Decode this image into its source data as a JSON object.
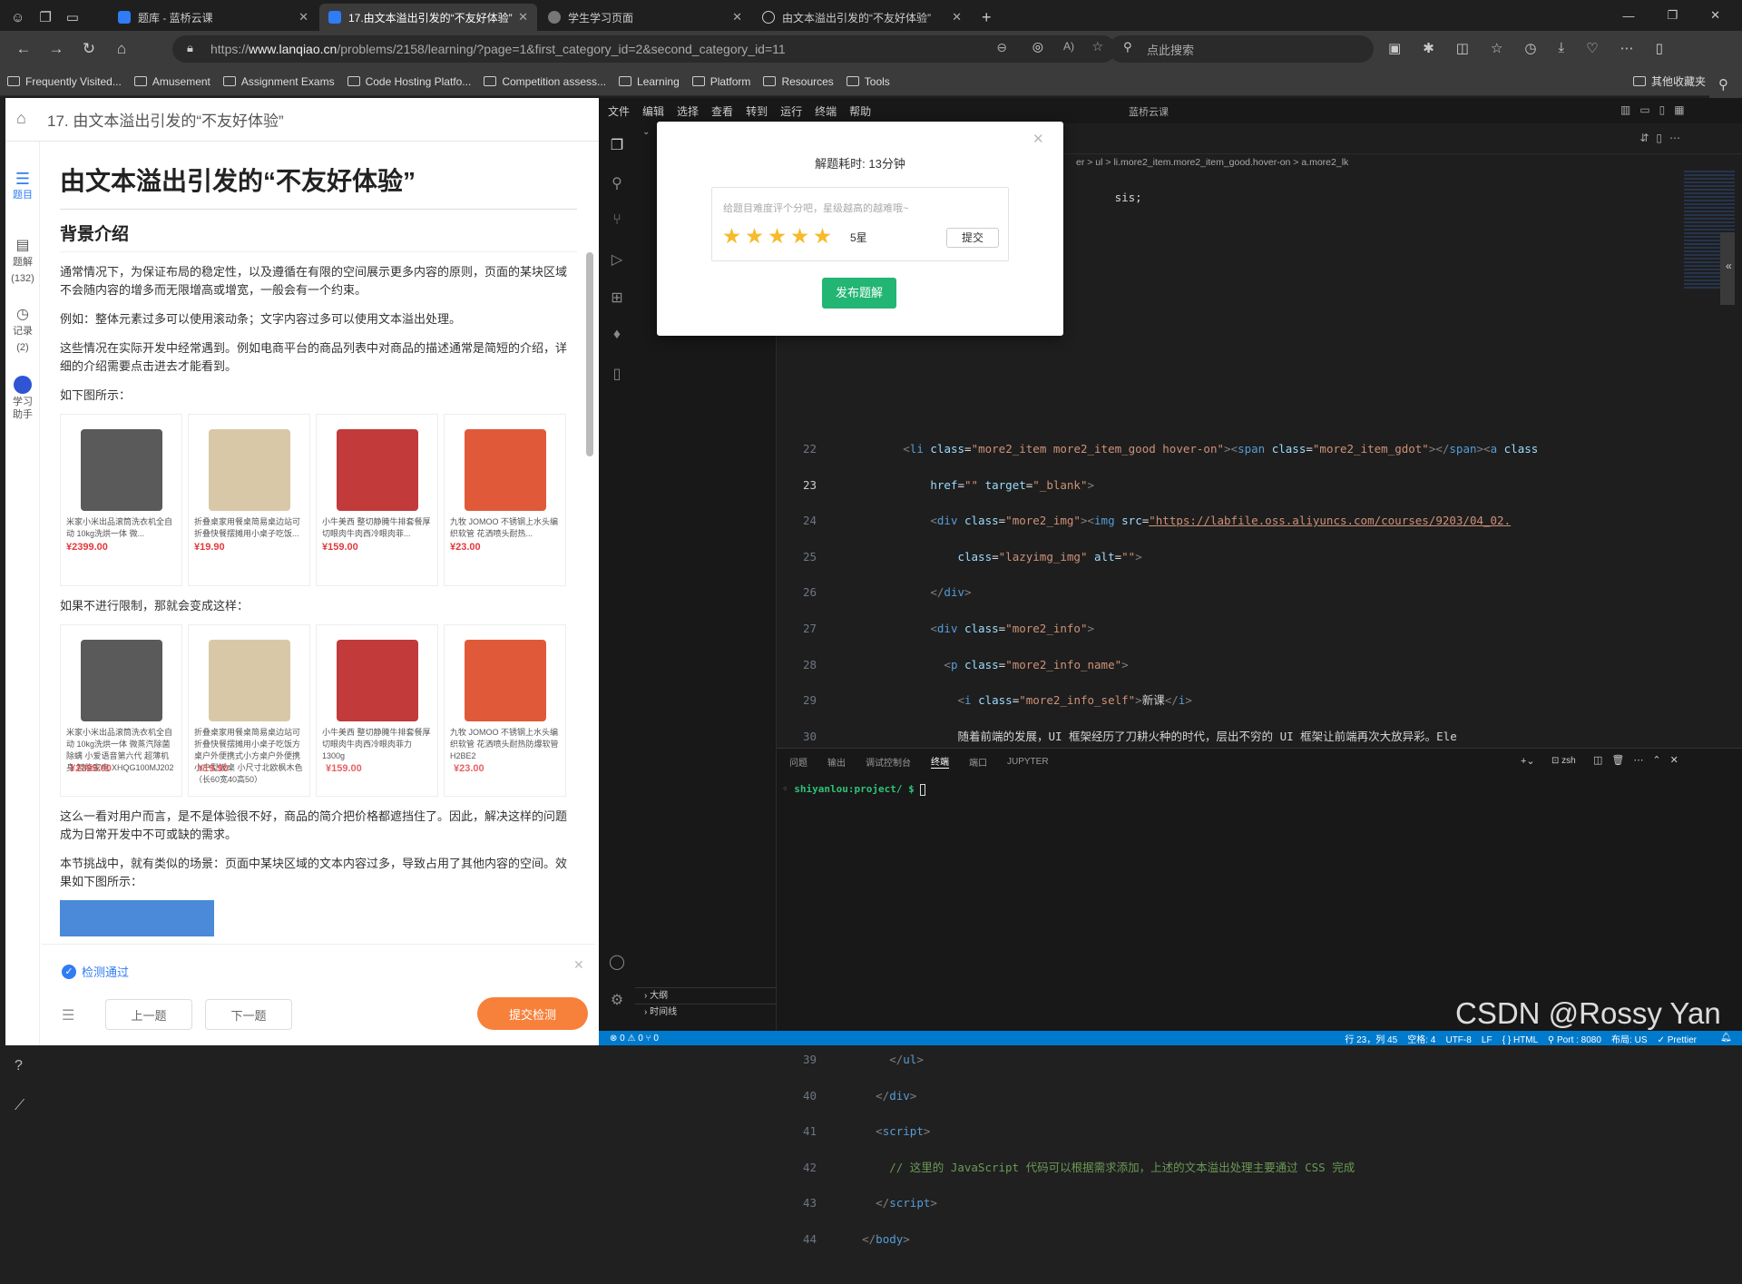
{
  "tabs": [
    {
      "label": "题库 - 蓝桥云课",
      "color": "#2f7cf6",
      "active": false
    },
    {
      "label": "17.由文本溢出引发的“不友好体验”",
      "color": "#2f7cf6",
      "active": true
    },
    {
      "label": "学生学习页面",
      "color": "#888888",
      "active": false
    },
    {
      "label": "由文本溢出引发的“不友好体验”",
      "color": "#888888",
      "active": false
    }
  ],
  "address": {
    "prefix": "https://",
    "domain": "www.lanqiao.cn",
    "path": "/problems/2158/learning/?page=1&first_category_id=2&second_category_id=11"
  },
  "search": {
    "placeholder": "点此搜索"
  },
  "bookmarks": [
    "Frequently Visited...",
    "Amusement",
    "Assignment Exams",
    "Code Hosting Platfo...",
    "Competition assess...",
    "Learning",
    "Platform",
    "Resources",
    "Tools"
  ],
  "bookmark_right": "其他收藏夹",
  "left": {
    "header_title": "17. 由文本溢出引发的“不友好体验”",
    "nav": [
      {
        "label": "题目",
        "sub": ""
      },
      {
        "label": "题解",
        "sub": "(132)"
      },
      {
        "label": "记录",
        "sub": "(2)"
      },
      {
        "label": "学习助手",
        "sub": ""
      }
    ],
    "title": "由文本溢出引发的“不友好体验”",
    "section": "背景介绍",
    "p1": "通常情况下，为保证布局的稳定性，以及遵循在有限的空间展示更多内容的原则，页面的某块区域不会随内容的增多而无限增高或增宽，一般会有一个约束。",
    "p2": "例如：整体元素过多可以使用滚动条；文字内容过多可以使用文本溢出处理。",
    "p3": "这些情况在实际开发中经常遇到。例如电商平台的商品列表中对商品的描述通常是简短的介绍，详细的介绍需要点击进去才能看到。",
    "p4": "如下图所示：",
    "p5": "如果不进行限制，那就会变成这样：",
    "p6": "这么一看对用户而言，是不是体验很不好，商品的简介把价格都遮挡住了。因此，解决这样的问题成为日常开发中不可或缺的需求。",
    "p7": "本节挑战中，就有类似的场景：页面中某块区域的文本内容过多，导致占用了其他内容的空间。效果如下图所示：",
    "products": [
      {
        "desc": "米家小米出品滚筒洗衣机全自动 10kg洗烘一体 微...",
        "price": "¥2399.00",
        "color": "#5a5a5a"
      },
      {
        "desc": "折叠桌家用餐桌简易桌边站可折叠快餐摆摊用小桌子吃饭...",
        "price": "¥19.90",
        "color": "#d9c8a8"
      },
      {
        "desc": "小牛美西 整切静腌牛排套餐厚切眼肉牛肉西冷眼肉菲...",
        "price": "¥159.00",
        "color": "#c23a3a"
      },
      {
        "desc": "九牧 JOMOO 不锈钢上水头编织软管 花洒喷头耐热...",
        "price": "¥23.00",
        "color": "#e05a3a"
      }
    ],
    "products_overflow": [
      {
        "desc": "米家小米出品滚筒洗衣机全自动 10kg洗烘一体 微蒸汽除菌除螨 小爱语音第六代 超薄机身  智能家电 XHQG100MJ202",
        "price": "¥2399.00",
        "color": "#5a5a5a"
      },
      {
        "desc": "折叠桌家用餐桌简易桌边站可折叠快餐摆摊用小桌子吃饭方桌户外便携式小方桌户外便携 小户型饭桌 小尺寸北欧枫木色（长60宽40高50）",
        "price": "¥19.90",
        "color": "#d9c8a8"
      },
      {
        "desc": "小牛美西 整切静腌牛排套餐厚切眼肉牛肉西冷眼肉菲力 1300g",
        "price": "¥159.00",
        "color": "#c23a3a"
      },
      {
        "desc": "九牧 JOMOO 不锈钢上水头编织软管 花洒喷头耐热防爆软管 H2BE2",
        "price": "¥23.00",
        "color": "#e05a3a"
      }
    ],
    "check_status": "检测通过",
    "prev": "上一题",
    "next": "下一题",
    "submit": "提交检测"
  },
  "vscode": {
    "menu": [
      "文件",
      "编辑",
      "选择",
      "查看",
      "转到",
      "运行",
      "终端",
      "帮助"
    ],
    "title": "蓝桥云课",
    "breadcrumb": "er > ul > li.more2_item.more2_item_good.hover-on > a.more2_lk",
    "panel_tabs": [
      "问题",
      "输出",
      "调试控制台",
      "终端",
      "端口",
      "JUPYTER"
    ],
    "panel_right": "zsh",
    "terminal_prompt": "shiyanlou:project/ $",
    "outline": "大纲",
    "timeline": "时间线",
    "status_left": "⊗ 0 ⚠ 0   ⑂ 0",
    "status_right": "行 23，列 45    空格: 4    UTF-8    LF    { } HTML    ⚲ Port : 8080    布局: US    ✓ Prettier"
  },
  "modal": {
    "time_text": "解题耗时: 13分钟",
    "hint": "给题目难度评个分吧，星级越高的越难哦~",
    "stars": 5,
    "rating_text": "5星",
    "submit": "提交",
    "publish": "发布题解"
  },
  "watermark": "CSDN @Rossy Yan"
}
